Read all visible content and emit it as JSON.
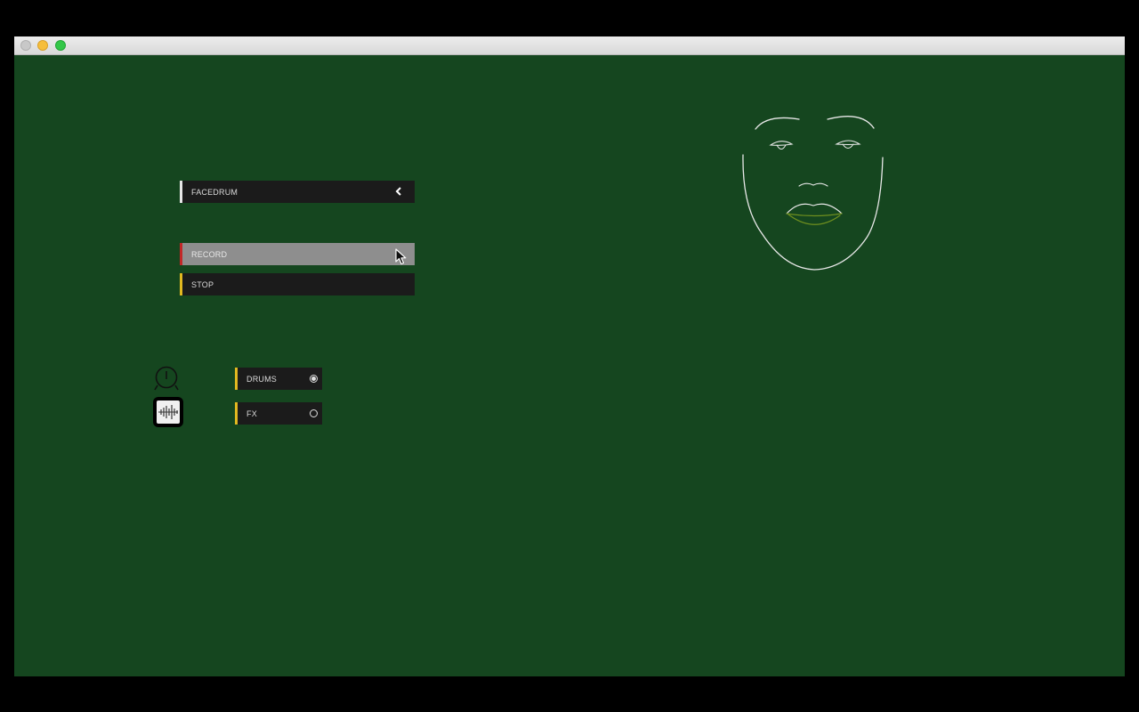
{
  "window": {
    "buttons": [
      "close",
      "minimize",
      "maximize"
    ]
  },
  "panel": {
    "title_bar": {
      "label": "FACEDRUM",
      "icon": "chevron-left-icon"
    },
    "record": {
      "label": "RECORD"
    },
    "stop": {
      "label": "STOP"
    }
  },
  "modes": [
    {
      "label": "DRUMS",
      "selected": true,
      "icon": "drum-icon"
    },
    {
      "label": "FX",
      "selected": false,
      "icon": "waveform-icon"
    }
  ],
  "colors": {
    "background": "#15461f",
    "bar": "#1b1b1b",
    "record_accent": "#c22727",
    "yellow_accent": "#e1b820",
    "face_line": "#e8e8e8",
    "mouth_line": "#6f8f1f"
  }
}
